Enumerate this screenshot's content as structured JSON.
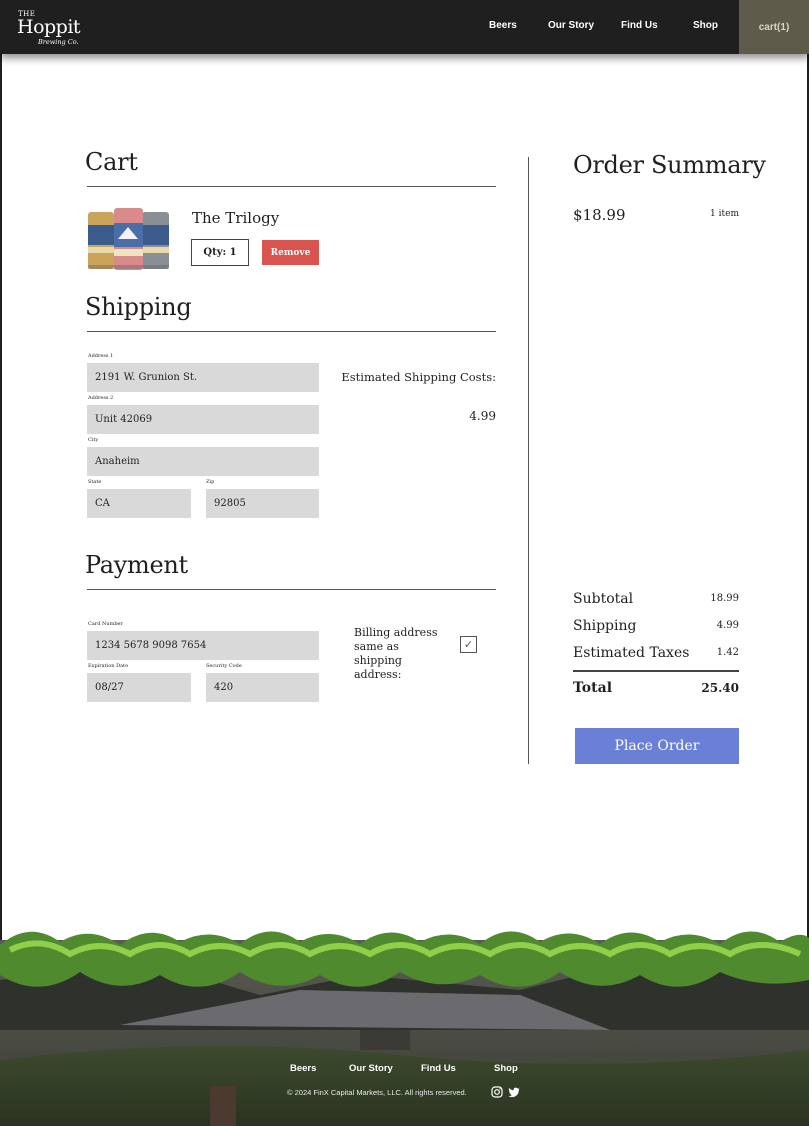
{
  "header": {
    "logo": {
      "the": "THE",
      "name": "Hoppit",
      "sub": "Brewing Co."
    },
    "nav": [
      "Beers",
      "Our Story",
      "Find Us",
      "Shop"
    ],
    "cart_label": "cart(1)"
  },
  "cart": {
    "title": "Cart",
    "item": {
      "name": "The Trilogy",
      "qty_label": "Qty: 1",
      "remove_label": "Remove"
    }
  },
  "shipping": {
    "title": "Shipping",
    "address1": {
      "label": "Address 1",
      "value": "2191 W. Grunion St."
    },
    "address2": {
      "label": "Address 2",
      "value": "Unit 42069"
    },
    "city": {
      "label": "City",
      "value": "Anaheim"
    },
    "state": {
      "label": "State",
      "value": "CA"
    },
    "zip": {
      "label": "Zip",
      "value": "92805"
    },
    "estimate_label": "Estimated Shipping Costs:",
    "estimate_value": "4.99"
  },
  "payment": {
    "title": "Payment",
    "card_number": {
      "label": "Card Number",
      "value": "1234 5678 9098 7654"
    },
    "expiration": {
      "label": "Expiration Date",
      "value": "08/27"
    },
    "security": {
      "label": "Security Code",
      "value": "420"
    },
    "billing_same_label": "Billing address same as shipping address:",
    "billing_same_checked": true
  },
  "summary": {
    "title": "Order Summary",
    "price": "$18.99",
    "item_count": "1 item",
    "rows": [
      {
        "label": "Subtotal",
        "value": "18.99"
      },
      {
        "label": "Shipping",
        "value": "4.99"
      },
      {
        "label": "Estimated Taxes",
        "value": "1.42"
      }
    ],
    "total_label": "Total",
    "total_value": "25.40",
    "place_order_label": "Place Order"
  },
  "footer": {
    "nav": [
      "Beers",
      "Our Story",
      "Find Us",
      "Shop"
    ],
    "copyright": "© 2024 FinX Capital Markets, LLC. All rights reserved.",
    "social_icons": [
      "instagram-icon",
      "twitter-icon"
    ]
  },
  "colors": {
    "header_bg": "#1f1f1f",
    "cart_button_bg": "#5e5b4a",
    "remove_button": "#d9534f",
    "place_order_button": "#6a7fd6",
    "field_bg": "#d9d9d9"
  }
}
